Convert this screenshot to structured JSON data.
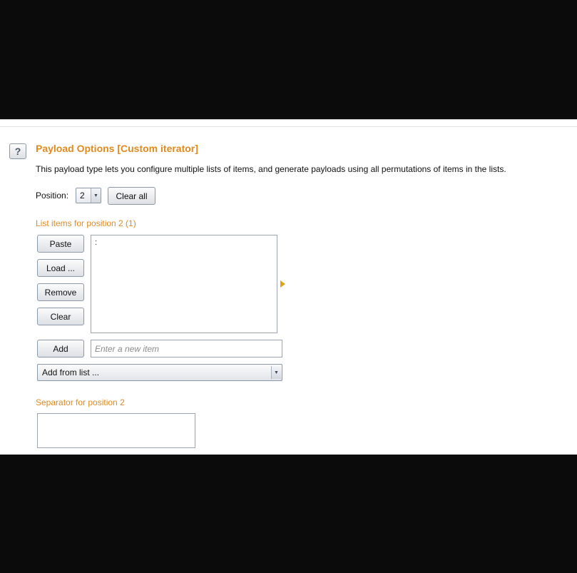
{
  "payload_options": {
    "help_icon": "question-mark-icon",
    "title": "Payload Options [Custom iterator]",
    "description": "This payload type lets you configure multiple lists of items, and generate payloads using all permutations of items in the lists.",
    "position_label": "Position:",
    "position_value": "2",
    "clear_all_label": "Clear all",
    "list_section_label": "List items for position 2 (1)",
    "list_buttons": {
      "paste": "Paste",
      "load": "Load ...",
      "remove": "Remove",
      "clear": "Clear"
    },
    "list_items": [
      ":"
    ],
    "add_label": "Add",
    "new_item_placeholder": "Enter a new item",
    "add_from_list_value": "Add from list ...",
    "separator_label": "Separator for position 2",
    "separator_value": ""
  },
  "colors": {
    "accent": "#e08a1e",
    "background": "#ffffff",
    "frame": "#0b0b0c"
  }
}
